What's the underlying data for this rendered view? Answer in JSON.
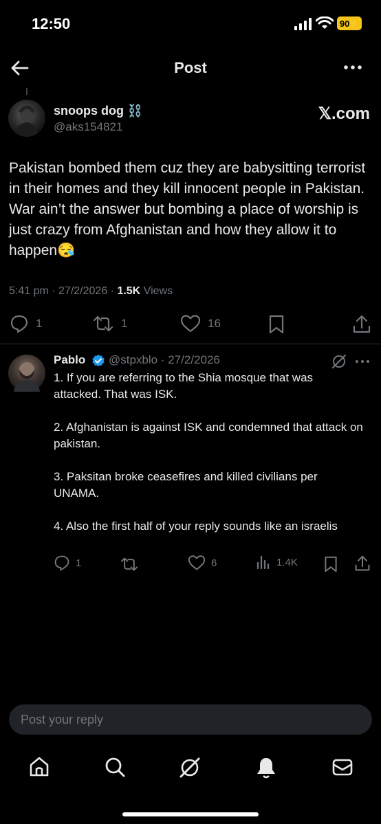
{
  "status_bar": {
    "time": "12:50",
    "battery": "90"
  },
  "header": {
    "title": "Post"
  },
  "post": {
    "author_name": "snoops dog ⛓️",
    "author_handle": "@aks154821",
    "source_label": "𝕏.com",
    "text": "Pakistan bombed them cuz they are babysitting terrorist in their homes and they kill innocent people in Pakistan. War ain’t the answer but bombing a place of worship is just crazy from Afghanistan and how they allow it to happen😪",
    "time": "5:41 pm · 27/2/2026 · ",
    "views_count": "1.5K",
    "views_label": " Views",
    "replies": "1",
    "reposts": "1",
    "likes": "16"
  },
  "reply": {
    "author_name": "Pablo",
    "author_handle": "@stpxblo · 27/2/2026",
    "paragraphs": [
      "1. If you are referring to the Shia mosque that was attacked. That was ISK.",
      "2. Afghanistan is against ISK and condemned that attack on pakistan.",
      "3. Paksitan broke ceasefires and killed civilians per UNAMA.",
      "4. Also the first half of your reply sounds like an israelis"
    ],
    "replies": "1",
    "likes": "6",
    "views": "1.4K"
  },
  "composer": {
    "placeholder": "Post your reply"
  },
  "colors": {
    "background": "#000000",
    "text": "#e7e9ea",
    "muted": "#71767b",
    "verified": "#1d9bf0",
    "battery": "#f5c518"
  }
}
